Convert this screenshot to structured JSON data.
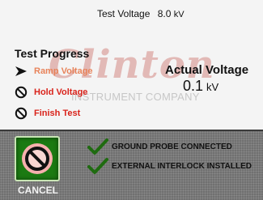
{
  "header": {
    "test_voltage_label": "Test Voltage",
    "test_voltage_value": "8.0",
    "test_voltage_unit": "kV"
  },
  "watermark": {
    "brand": "Clinton",
    "subtitle": "INSTRUMENT COMPANY"
  },
  "progress": {
    "title": "Test Progress",
    "steps": [
      {
        "label": "Ramp Voltage",
        "icon": "arrow-right-icon",
        "state": "active",
        "color": "#e8835a"
      },
      {
        "label": "Hold Voltage",
        "icon": "prohibited-icon",
        "state": "pending",
        "color": "#d9231b"
      },
      {
        "label": "Finish Test",
        "icon": "prohibited-icon",
        "state": "pending",
        "color": "#d9231b"
      }
    ]
  },
  "actual": {
    "title": "Actual Voltage",
    "value": "0.1",
    "unit": "kV"
  },
  "controls": {
    "cancel_label": "CANCEL",
    "cancel_icon": "prohibited-icon"
  },
  "status": [
    {
      "text": "GROUND PROBE CONNECTED",
      "icon": "checkmark-icon"
    },
    {
      "text": "EXTERNAL INTERLOCK INSTALLED",
      "icon": "checkmark-icon"
    }
  ],
  "colors": {
    "active_step": "#e8835a",
    "pending_step": "#d9231b",
    "cancel_button": "#1b7a12",
    "check": "#1f6b10",
    "panel": "#707070"
  }
}
